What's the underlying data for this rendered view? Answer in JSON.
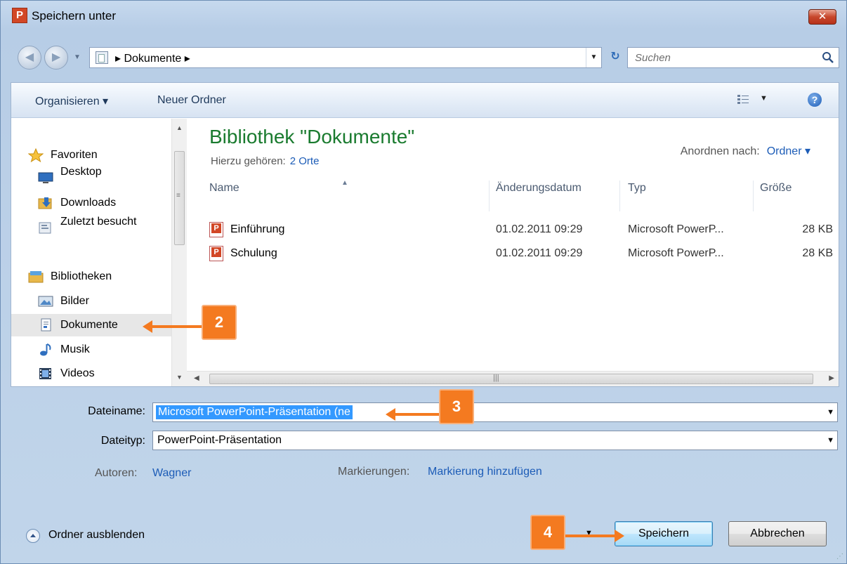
{
  "window": {
    "title": "Speichern unter",
    "app_icon": "P",
    "close": "✕"
  },
  "navbar": {
    "back_icon": "arrow-left-icon",
    "forward_icon": "arrow-right-icon",
    "path": "▸ Dokumente ▸",
    "search_placeholder": "Suchen"
  },
  "toolbar": {
    "organize": "Organisieren ▾",
    "new_folder": "Neuer Ordner",
    "help": "?"
  },
  "sidebar": {
    "favorites": {
      "label": "Favoriten",
      "items": [
        "Desktop",
        "Downloads",
        "Zuletzt besucht"
      ]
    },
    "libraries": {
      "label": "Bibliotheken",
      "items": [
        "Bilder",
        "Dokumente",
        "Musik",
        "Videos"
      ]
    },
    "selected": "Dokumente"
  },
  "library": {
    "title": "Bibliothek \"Dokumente\"",
    "includes_label": "Hierzu gehören:",
    "includes_link": "2 Orte",
    "arrange_label": "Anordnen nach:",
    "arrange_value": "Ordner ▾"
  },
  "columns": [
    "Name",
    "Änderungsdatum",
    "Typ",
    "Größe"
  ],
  "files": [
    {
      "name": "Einführung",
      "date": "01.02.2011 09:29",
      "type": "Microsoft PowerP...",
      "size": "28 KB"
    },
    {
      "name": "Schulung",
      "date": "01.02.2011 09:29",
      "type": "Microsoft PowerP...",
      "size": "28 KB"
    }
  ],
  "form": {
    "filename_label": "Dateiname:",
    "filename_value": "Microsoft PowerPoint-Präsentation (ne",
    "filetype_label": "Dateityp:",
    "filetype_value": "PowerPoint-Präsentation",
    "authors_label": "Autoren:",
    "authors_value": "Wagner",
    "tags_label": "Markierungen:",
    "tags_value": "Markierung hinzufügen"
  },
  "footer": {
    "hide_folders": "Ordner ausblenden",
    "save": "Speichern",
    "cancel": "Abbrechen"
  },
  "annotations": [
    "2",
    "3",
    "4"
  ],
  "colors": {
    "accent": "#f47a20",
    "link": "#1c5cb7",
    "library_title": "#1a7b2f",
    "selection": "#3399ff"
  }
}
